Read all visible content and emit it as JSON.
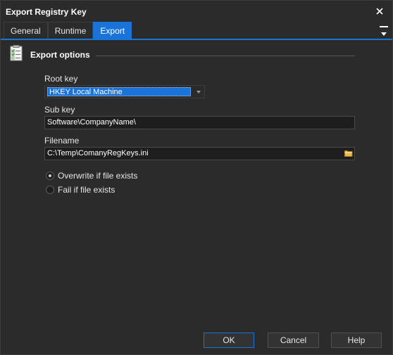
{
  "window": {
    "title": "Export Registry Key"
  },
  "tabs": [
    {
      "label": "General",
      "active": false
    },
    {
      "label": "Runtime",
      "active": false
    },
    {
      "label": "Export",
      "active": true
    }
  ],
  "section": {
    "title": "Export options",
    "icon": "checklist-icon"
  },
  "fields": {
    "root_key": {
      "label": "Root key",
      "value": "HKEY Local Machine"
    },
    "sub_key": {
      "label": "Sub key",
      "value": "Software\\CompanyName\\"
    },
    "filename": {
      "label": "Filename",
      "value": "C:\\Temp\\ComanyRegKeys.ini"
    }
  },
  "options": [
    {
      "label": "Overwrite if file exists",
      "checked": true
    },
    {
      "label": "Fail if file exists",
      "checked": false
    }
  ],
  "buttons": {
    "ok": "OK",
    "cancel": "Cancel",
    "help": "Help"
  },
  "colors": {
    "accent": "#1a73d9",
    "background": "#2b2b2b"
  }
}
